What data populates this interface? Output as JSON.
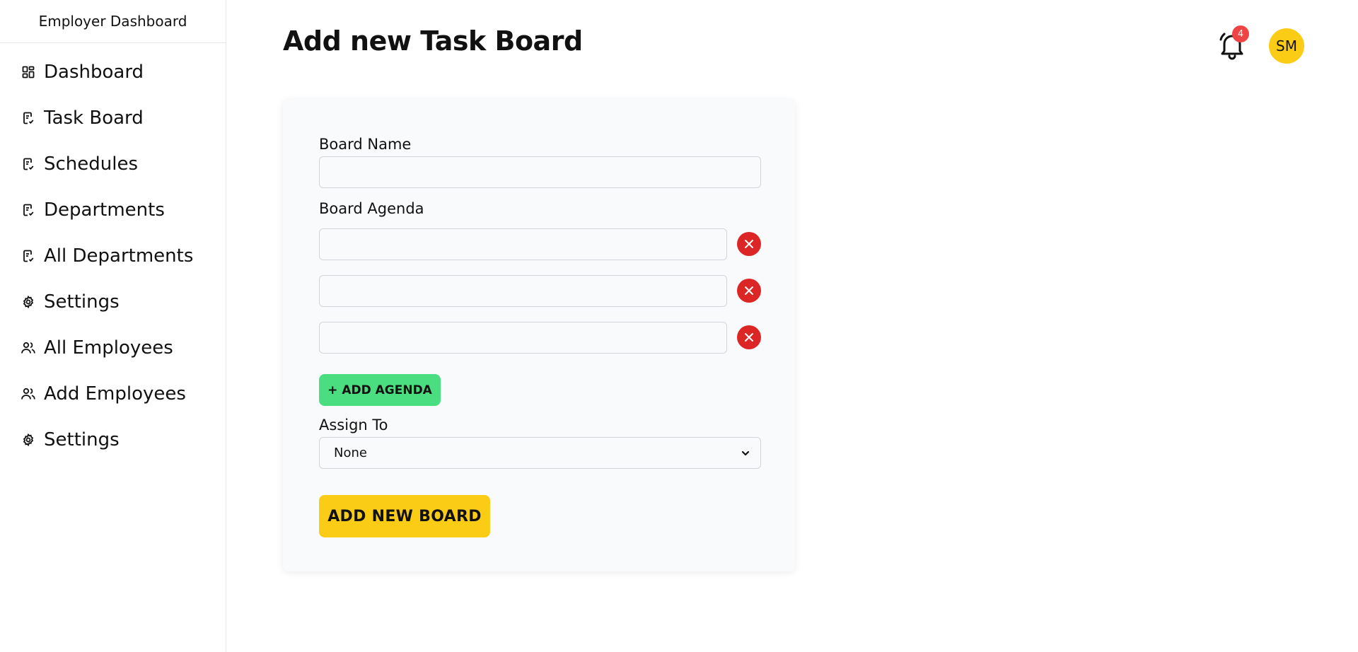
{
  "sidebar": {
    "title": "Employer Dashboard",
    "items": [
      {
        "label": "Dashboard",
        "icon": "dashboard-grid-icon"
      },
      {
        "label": "Task Board",
        "icon": "clipboard-icon"
      },
      {
        "label": "Schedules",
        "icon": "clipboard-icon"
      },
      {
        "label": "Departments",
        "icon": "clipboard-icon"
      },
      {
        "label": "All Departments",
        "icon": "clipboard-icon"
      },
      {
        "label": "Settings",
        "icon": "gear-icon"
      },
      {
        "label": "All Employees",
        "icon": "users-icon"
      },
      {
        "label": "Add Employees",
        "icon": "users-icon"
      },
      {
        "label": "Settings",
        "icon": "gear-icon"
      }
    ]
  },
  "header": {
    "title": "Add new Task Board",
    "notification_count": "4",
    "avatar_initials": "SM"
  },
  "form": {
    "board_name_label": "Board Name",
    "board_name_value": "",
    "board_agenda_label": "Board Agenda",
    "agenda_items": [
      "",
      "",
      ""
    ],
    "add_agenda_label": "+ ADD AGENDA",
    "assign_to_label": "Assign To",
    "assign_to_value": "None",
    "submit_label": "ADD NEW BOARD"
  },
  "colors": {
    "accent_yellow": "#facc15",
    "add_green": "#4ade80",
    "remove_red": "#dc2626",
    "badge_red": "#ef4444"
  }
}
